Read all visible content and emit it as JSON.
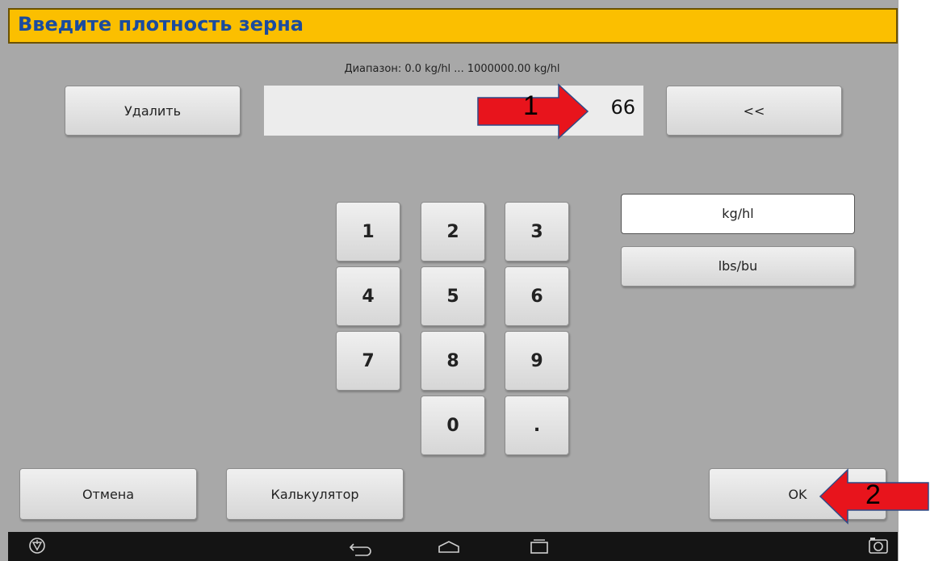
{
  "header": {
    "title": "Введите плотность зерна"
  },
  "range": {
    "label": "Диапазон: 0.0 kg/hl ... 1000000.00 kg/hl"
  },
  "input": {
    "value": "66"
  },
  "buttons": {
    "delete": "Удалить",
    "backspace": "<<",
    "cancel": "Отмена",
    "calculator": "Калькулятор",
    "ok": "OK"
  },
  "keypad": [
    "1",
    "2",
    "3",
    "4",
    "5",
    "6",
    "7",
    "8",
    "9",
    "0",
    "."
  ],
  "units": [
    {
      "label": "kg/hl",
      "selected": true
    },
    {
      "label": "lbs/bu",
      "selected": false
    }
  ],
  "annotations": [
    "1",
    "2"
  ],
  "colors": {
    "header_bg": "#fbbf00",
    "title_text": "#1a4b9e",
    "arrow": "#e8141c",
    "screen_bg": "#a8a8a8"
  },
  "icons": [
    "brand-logo-icon",
    "back-icon",
    "home-icon",
    "recent-apps-icon",
    "screenshot-camera-icon"
  ]
}
